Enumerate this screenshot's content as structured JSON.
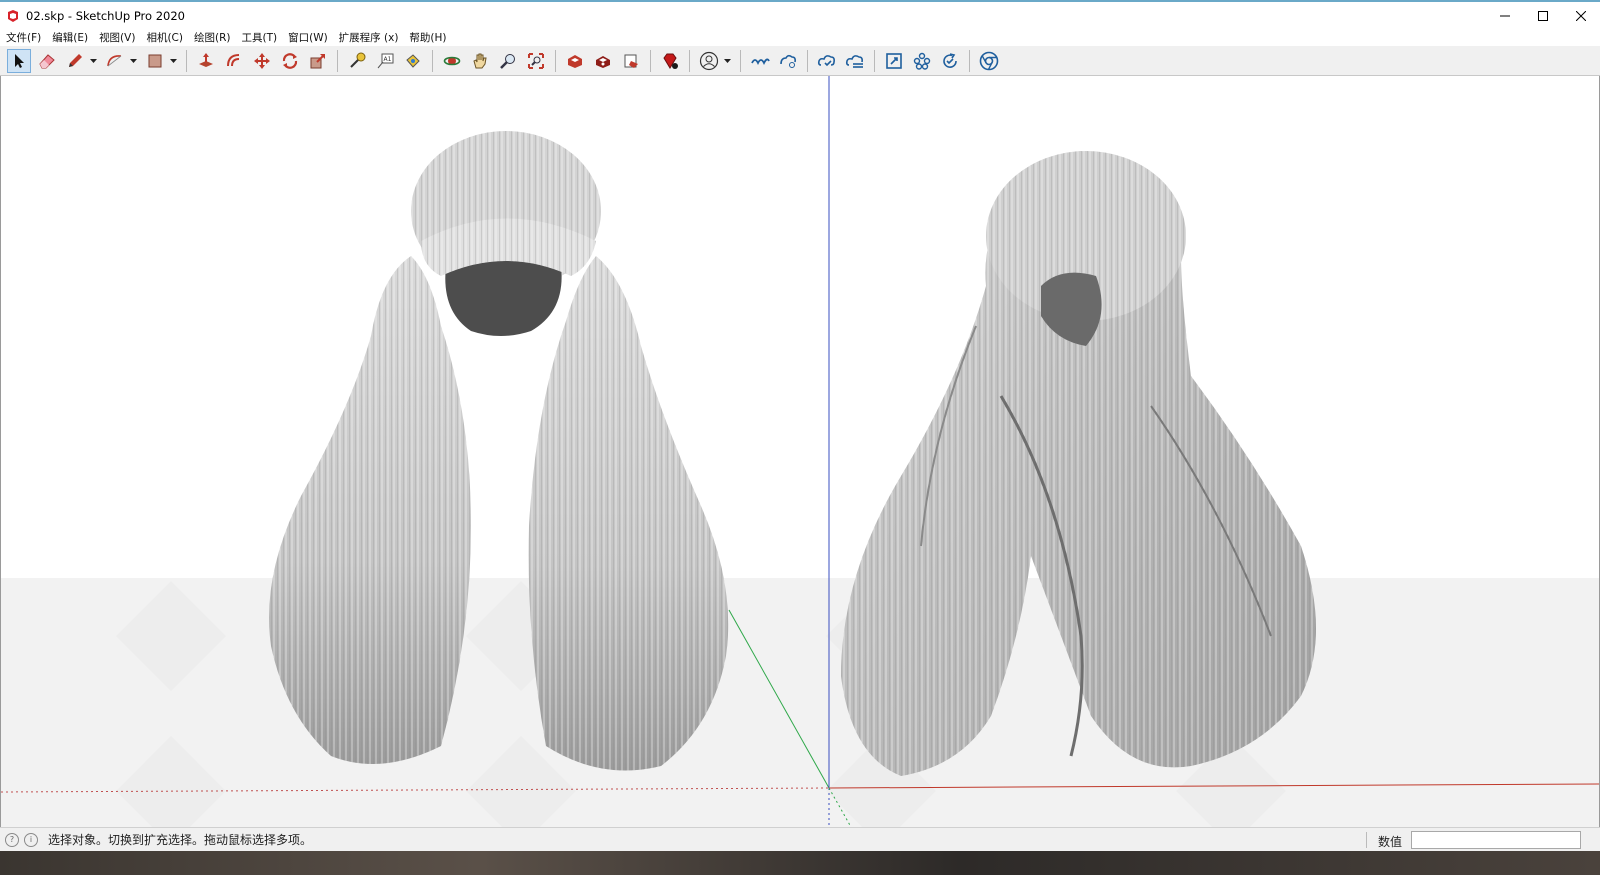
{
  "window": {
    "title": "02.skp - SketchUp Pro 2020",
    "app_icon": "sketchup-icon",
    "controls": [
      "minimize-icon",
      "maximize-icon",
      "close-icon"
    ]
  },
  "menu": {
    "items": [
      "文件(F)",
      "编辑(E)",
      "视图(V)",
      "相机(C)",
      "绘图(R)",
      "工具(T)",
      "窗口(W)",
      "扩展程序 (x)",
      "帮助(H)"
    ]
  },
  "toolbar": {
    "groups": [
      [
        "select-icon",
        "eraser-icon",
        "pencil-icon",
        "arc-icon",
        "rectangle-icon"
      ],
      [
        "push-pull-icon",
        "offset-icon",
        "move-icon",
        "rotate-icon",
        "scale-icon"
      ],
      [
        "tape-measure-icon",
        "text-icon",
        "paint-bucket-icon"
      ],
      [
        "orbit-icon",
        "pan-icon",
        "zoom-icon",
        "zoom-extents-icon"
      ],
      [
        "warehouse-icon",
        "extension-warehouse-icon",
        "layout-icon"
      ],
      [
        "ruby-icon"
      ],
      [
        "account-icon"
      ],
      [
        "trimble-connect-icon",
        "trimble-share-icon"
      ],
      [
        "cloud-upload-icon",
        "cloud-sync-icon"
      ],
      [
        "section-icon",
        "components-icon",
        "refresh-icon"
      ],
      [
        "chrome-icon"
      ]
    ]
  },
  "viewport": {
    "models": [
      "hair-model-front",
      "hair-model-side"
    ],
    "axis_colors": {
      "green": "#2fa84a",
      "red": "#c0392b",
      "blue": "#3a4fc0"
    }
  },
  "status": {
    "hint": "选择对象。切换到扩充选择。拖动鼠标选择多项。",
    "measurement_label": "数值",
    "measurement_value": ""
  }
}
